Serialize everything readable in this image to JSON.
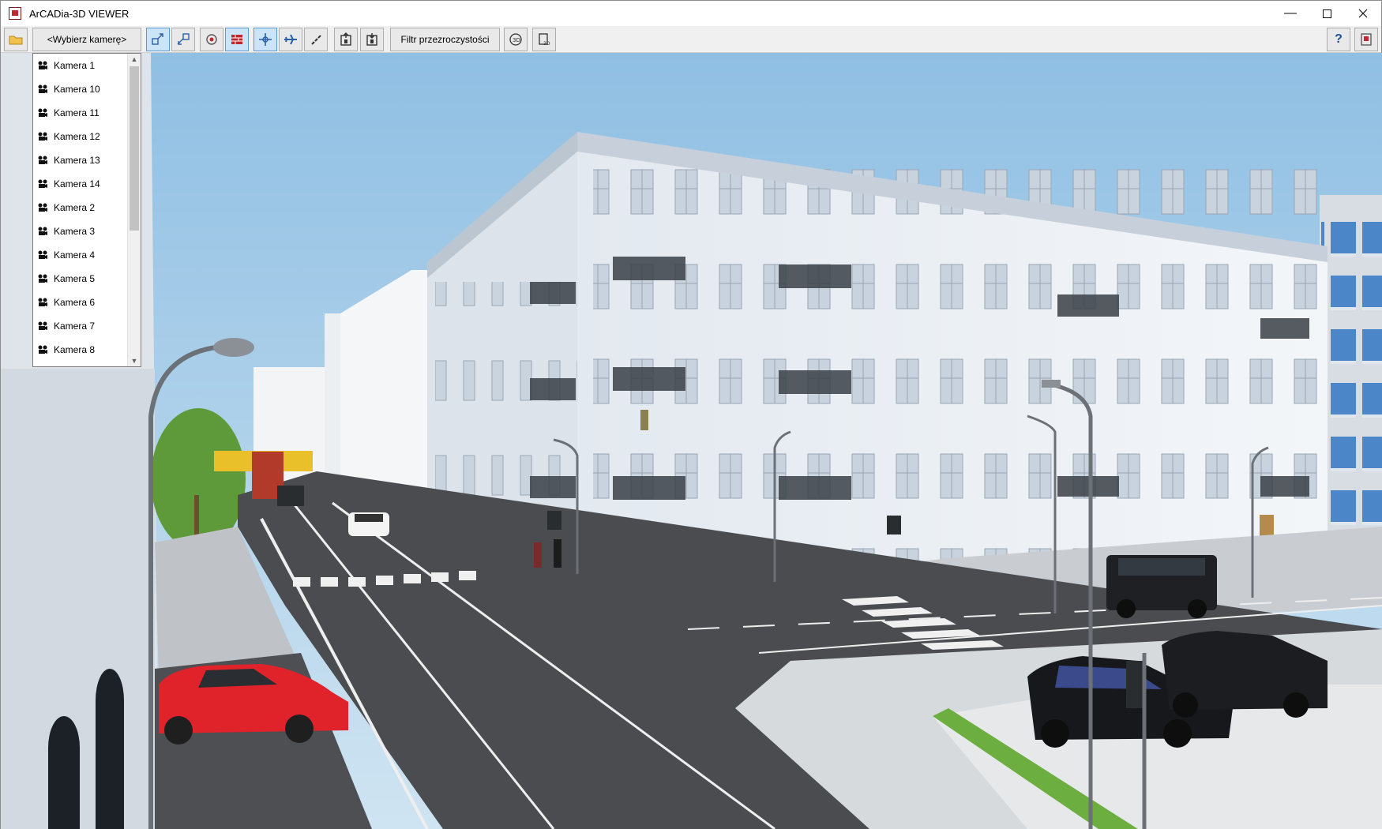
{
  "window": {
    "title": "ArCADia-3D VIEWER"
  },
  "toolbar": {
    "camera_select_label": "<Wybierz kamerę>",
    "transparency_filter_label": "Filtr przezroczystości",
    "help_label": "?"
  },
  "camera_list": [
    "Kamera 1",
    "Kamera 10",
    "Kamera 11",
    "Kamera 12",
    "Kamera 13",
    "Kamera 14",
    "Kamera 2",
    "Kamera 3",
    "Kamera 4",
    "Kamera 5",
    "Kamera 6",
    "Kamera 7",
    "Kamera 8"
  ],
  "colors": {
    "accent": "#5a9bd5",
    "active_button": "#cce4f7",
    "sky": "#9dc7e6"
  },
  "icons": {
    "open": "folder-icon",
    "zoom_in": "zoom-in-icon",
    "zoom_out": "zoom-out-icon",
    "orbit": "orbit-icon",
    "section": "section-icon",
    "pan": "pan-icon",
    "fly": "airplane-icon",
    "walk": "walk-icon",
    "elevator_up": "elevator-up-icon",
    "elevator_down": "elevator-down-icon",
    "rotate_3d": "rotate-3d-icon",
    "export_3d": "export-3d-icon",
    "exit": "exit-icon"
  }
}
